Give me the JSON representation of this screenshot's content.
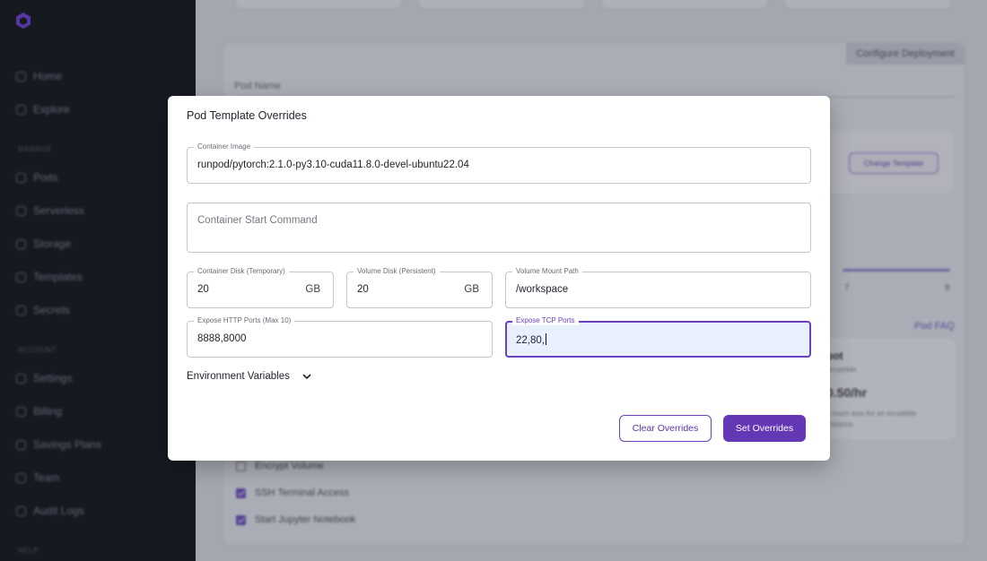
{
  "sidebar": {
    "items": [
      {
        "label": "Home",
        "icon": "home-icon"
      },
      {
        "label": "Explore",
        "icon": "compass-icon"
      },
      {
        "label": "Pods",
        "icon": "box-icon"
      },
      {
        "label": "Serverless",
        "icon": "cloud-icon"
      },
      {
        "label": "Storage",
        "icon": "folder-icon"
      },
      {
        "label": "Templates",
        "icon": "template-icon"
      },
      {
        "label": "Secrets",
        "icon": "key-icon"
      },
      {
        "label": "Settings",
        "icon": "gear-icon"
      },
      {
        "label": "Billing",
        "icon": "receipt-icon"
      },
      {
        "label": "Savings Plans",
        "icon": "tag-icon"
      },
      {
        "label": "Team",
        "icon": "team-icon"
      },
      {
        "label": "Audit Logs",
        "icon": "list-icon"
      }
    ],
    "sections": {
      "manage": "MANAGE",
      "account": "ACCOUNT",
      "help": "HELP"
    }
  },
  "background": {
    "configure_tab": "Configure Deployment",
    "pod_name_label": "Pod Name",
    "change_template": "Change Template",
    "ticks": [
      "7",
      "8"
    ],
    "pod_faq": "Pod FAQ",
    "spot": {
      "title": "pot",
      "subtitle": "erruptible",
      "price": "0.50/hr",
      "note": "y much less for an erruptible instance."
    },
    "options": [
      {
        "label": "Encrypt Volume",
        "checked": false
      },
      {
        "label": "SSH Terminal Access",
        "checked": true
      },
      {
        "label": "Start Jupyter Notebook",
        "checked": true
      }
    ]
  },
  "modal": {
    "title": "Pod Template Overrides",
    "container_image": {
      "label": "Container Image",
      "value": "runpod/pytorch:2.1.0-py3.10-cuda11.8.0-devel-ubuntu22.04"
    },
    "start_command": {
      "placeholder": "Container Start Command"
    },
    "container_disk": {
      "label": "Container Disk (Temporary)",
      "value": "20",
      "unit": "GB"
    },
    "volume_disk": {
      "label": "Volume Disk (Persistent)",
      "value": "20",
      "unit": "GB"
    },
    "mount_path": {
      "label": "Volume Mount Path",
      "value": "/workspace"
    },
    "http_ports": {
      "label": "Expose HTTP Ports (Max 10)",
      "value": "8888,8000"
    },
    "tcp_ports": {
      "label": "Expose TCP Ports",
      "value": "22,80,"
    },
    "env_label": "Environment Variables",
    "clear_button": "Clear Overrides",
    "set_button": "Set Overrides"
  },
  "colors": {
    "accent": "#6438b5",
    "focus_bg": "#e8f0fe",
    "sidebar_bg": "#16171d"
  }
}
